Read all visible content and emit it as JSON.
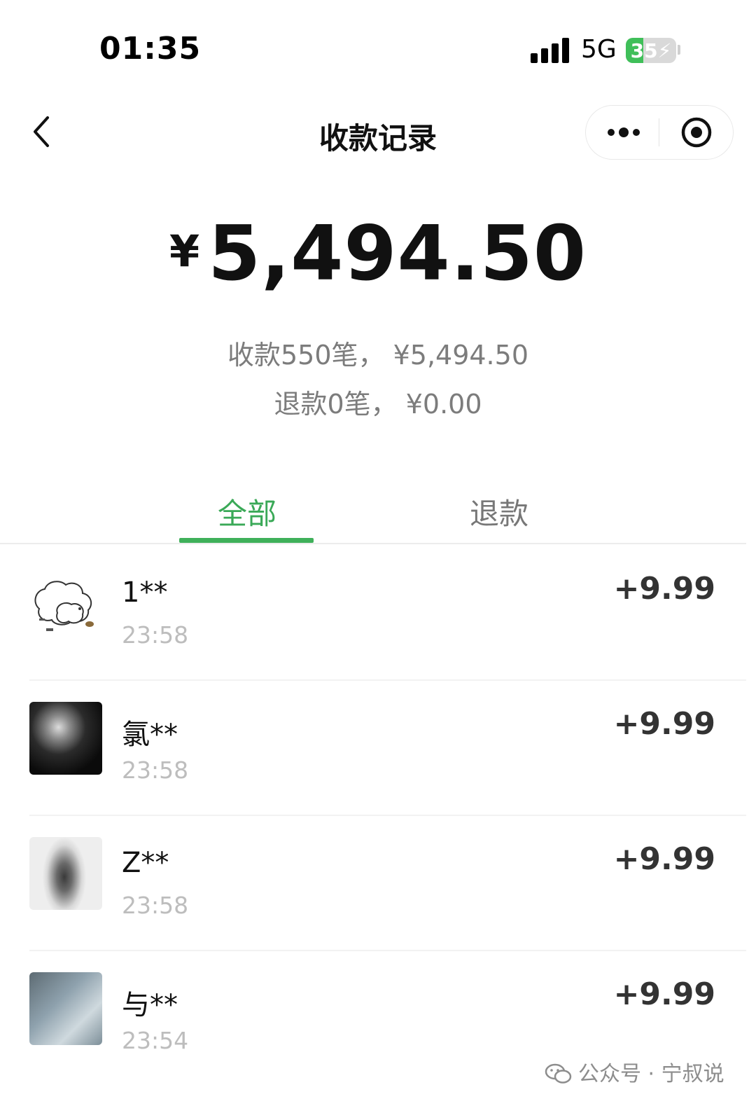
{
  "status_bar": {
    "time": "01:35",
    "network": "5G",
    "battery": "35",
    "battery_level": 0.35
  },
  "nav": {
    "title": "收款记录"
  },
  "summary": {
    "currency": "¥",
    "total": "5,494.50",
    "received_line": "收款550笔， ¥5,494.50",
    "refund_line": "退款0笔， ¥0.00"
  },
  "tabs": [
    {
      "label": "全部",
      "active": true
    },
    {
      "label": "退款",
      "active": false
    }
  ],
  "records": [
    {
      "name": "1**",
      "time": "23:58",
      "amount": "+9.99"
    },
    {
      "name": "氯**",
      "time": "23:58",
      "amount": "+9.99"
    },
    {
      "name": "Z**",
      "time": "23:58",
      "amount": "+9.99"
    },
    {
      "name": "与**",
      "time": "23:54",
      "amount": "+9.99"
    }
  ],
  "watermark": "公众号 · 宁叔说",
  "colors": {
    "accent": "#3aa957",
    "battery": "#3fbf59",
    "muted_text": "#7c7c7c",
    "time_text": "#bdbdbd"
  }
}
